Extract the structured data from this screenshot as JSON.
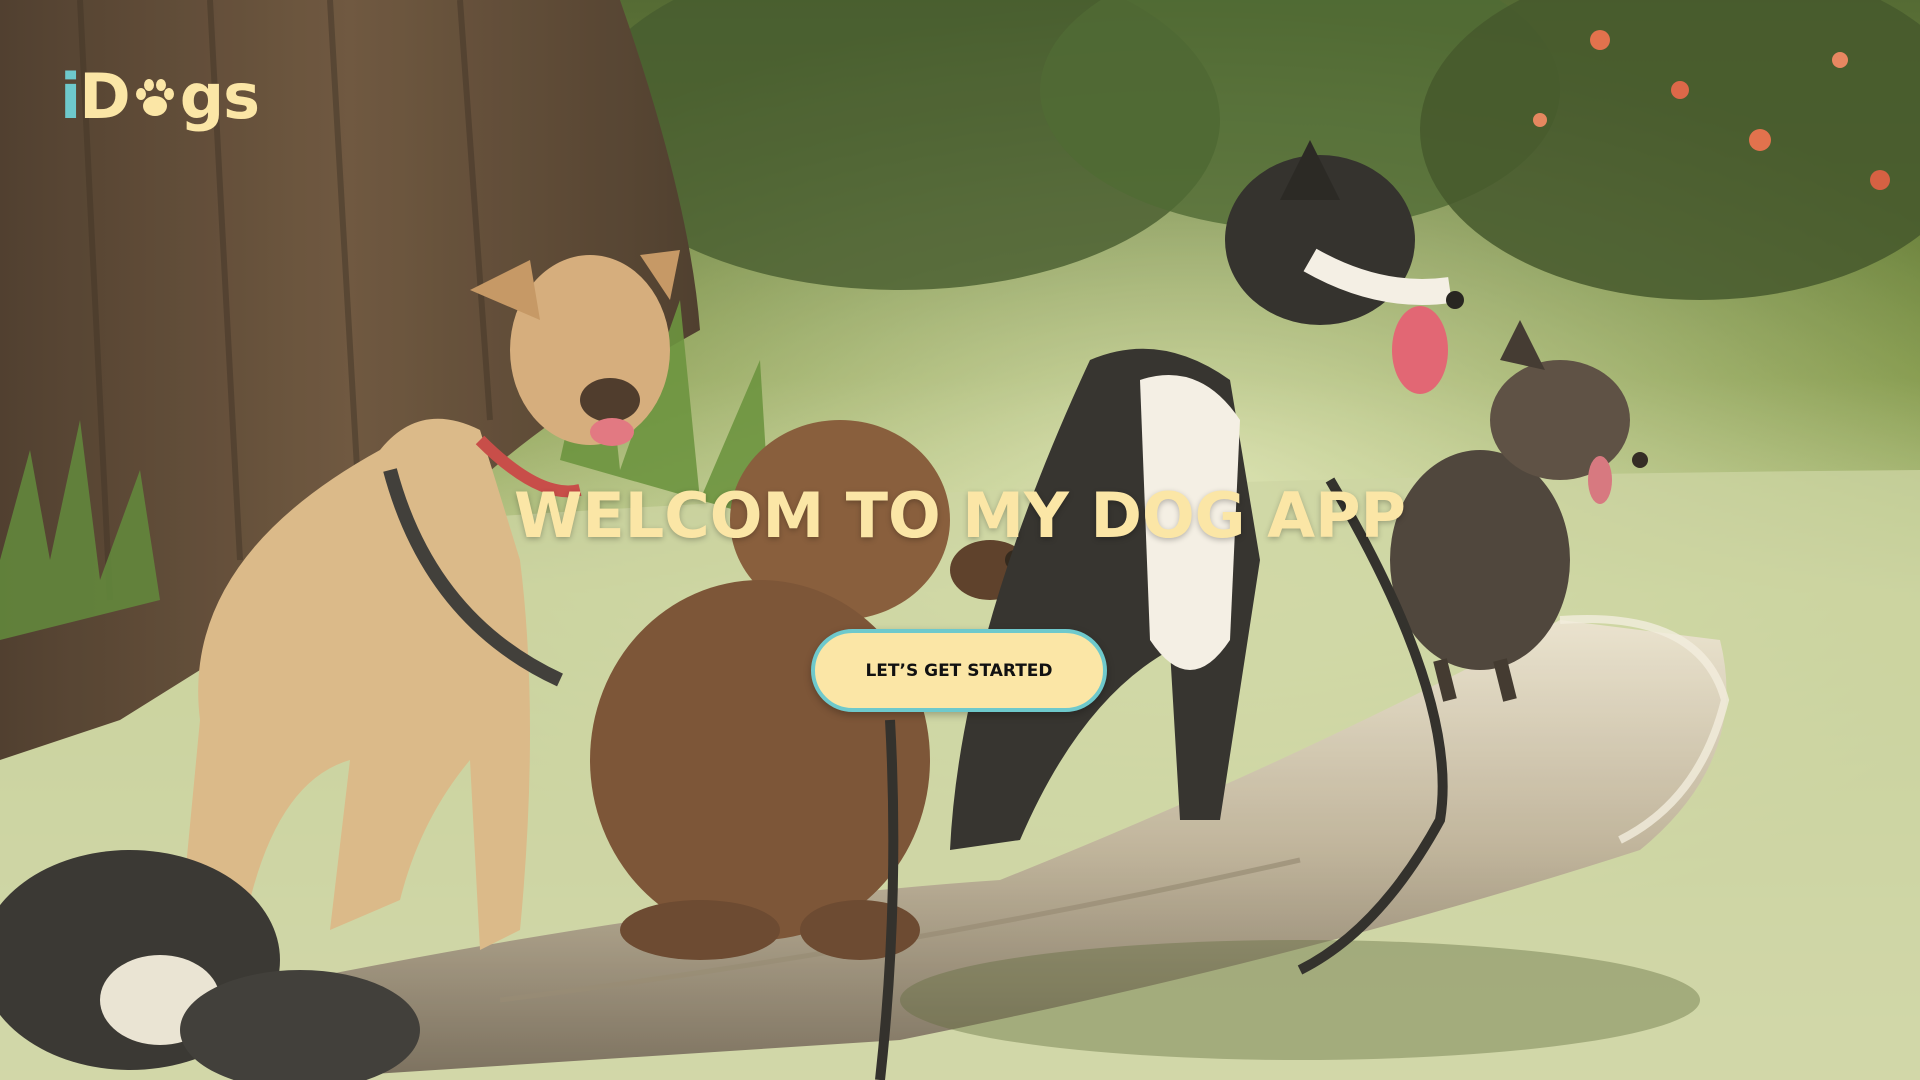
{
  "brand": {
    "logo_prefix": "i",
    "logo_suffix": "D",
    "logo_paw_icon": "paw-icon",
    "logo_end": "gs",
    "logo_full_text": "iDogs",
    "accent_color": "#6ec9cc",
    "cream_color": "#fbe6a6"
  },
  "hero": {
    "title": "WELCOM TO MY DOG APP",
    "cta_label": "LET’S GET STARTED"
  }
}
